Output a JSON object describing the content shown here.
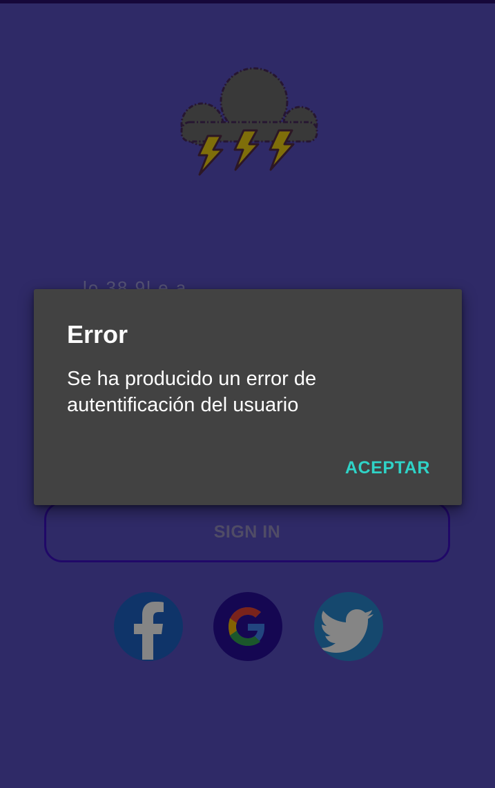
{
  "screen": {
    "hidden_text": "lo 38 9l e a"
  },
  "sign_in": {
    "label": "SIGN IN"
  },
  "dialog": {
    "title": "Error",
    "message": "Se ha producido un error de autentificación del usuario",
    "accept_label": "ACEPTAR"
  },
  "social": [
    {
      "name": "facebook-icon"
    },
    {
      "name": "google-icon"
    },
    {
      "name": "twitter-icon"
    }
  ],
  "colors": {
    "background": "#5a51c6",
    "dialog_background": "#424242",
    "accent": "#2fd3c7",
    "button_border": "#3f10c8"
  }
}
